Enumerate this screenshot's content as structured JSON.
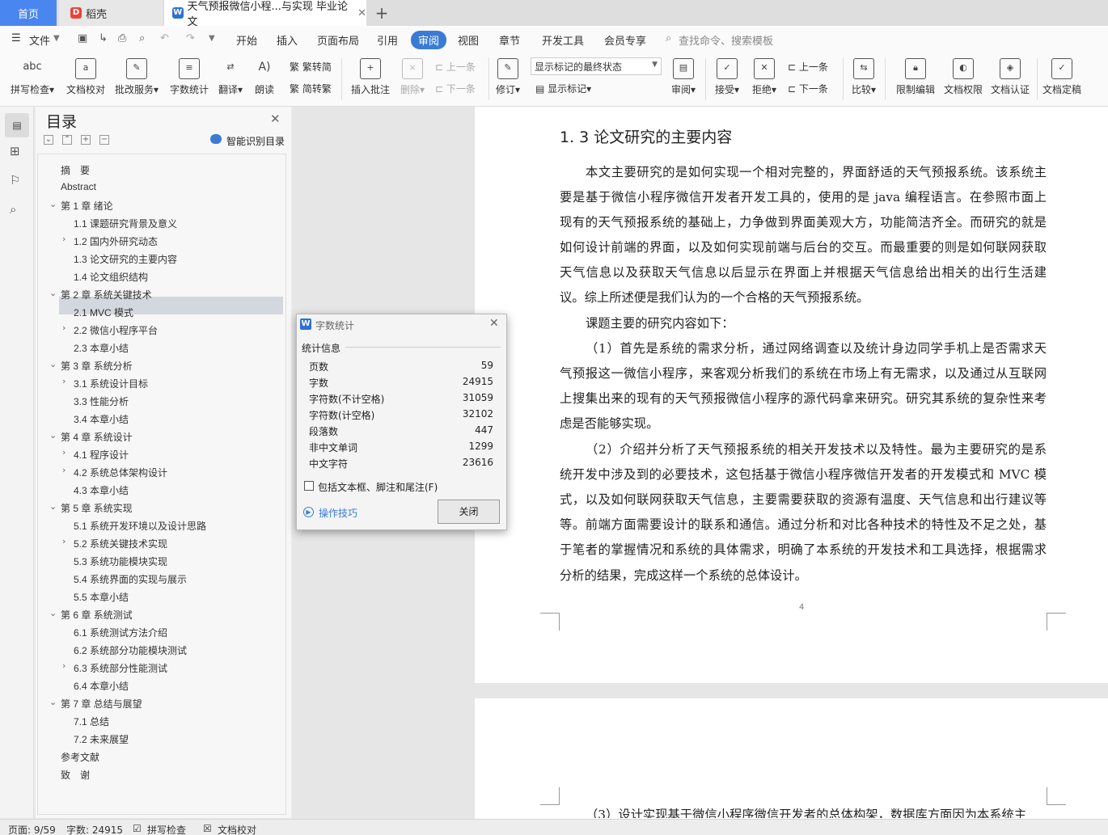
{
  "tabs": {
    "home": "首页",
    "daoke": "稻壳",
    "doc": "天气预报微信小程...与实现 毕业论文"
  },
  "menu": {
    "file": "文件",
    "items": [
      "开始",
      "插入",
      "页面布局",
      "引用",
      "审阅",
      "视图",
      "章节",
      "开发工具",
      "会员专享"
    ],
    "search": "查找命令、搜索模板"
  },
  "ribbon": {
    "spellcheck": "拼写检查",
    "doccheck": "文档校对",
    "annotate": "批改服务",
    "wordcount": "字数统计",
    "translate": "翻译",
    "read": "朗读",
    "trad": "繁转简",
    "simp": "简转繁",
    "insert_comment": "插入批注",
    "delete": "删除",
    "prev_disabled": "上一条",
    "next_disabled": "下一条",
    "revise": "修订",
    "markup_state": "显示标记的最终状态",
    "show_markup": "显示标记",
    "review": "审阅",
    "accept": "接受",
    "reject": "拒绝",
    "prev": "上一条",
    "next": "下一条",
    "compare": "比较",
    "restrict": "限制编辑",
    "perm": "文档权限",
    "auth": "文档认证",
    "finalize": "文档定稿"
  },
  "toc": {
    "title": "目录",
    "smart": "智能识别目录",
    "items": [
      "摘　要",
      "Abstract",
      "第 1 章  绪论",
      "1.1 课题研究背景及意义",
      "1.2 国内外研究动态",
      "1.3 论文研究的主要内容",
      "1.4 论文组织结构",
      "第 2 章  系统关键技术",
      "2.1 MVC 模式",
      "2.2  微信小程序平台",
      "2.3 本章小结",
      "第 3 章  系统分析",
      "3.1 系统设计目标",
      "3.3 性能分析",
      "3.4 本章小结",
      "第 4 章  系统设计",
      "4.1 程序设计",
      "4.2 系统总体架构设计",
      "4.3 本章小结",
      "第 5 章  系统实现",
      "5.1 系统开发环境以及设计思路",
      "5.2 系统关键技术实现",
      "5.3 系统功能模块实现",
      "5.4 系统界面的实现与展示",
      "5.5 本章小结",
      "第 6 章  系统测试",
      "6.1 系统测试方法介绍",
      "6.2 系统部分功能模块测试",
      "6.3 系统部分性能测试",
      "6.4 本章小结",
      "第 7 章  总结与展望",
      "7.1 总结",
      "7.2 未来展望",
      "参考文献",
      "致　谢"
    ]
  },
  "doc": {
    "heading": "1. 3 论文研究的主要内容",
    "lines": [
      "本文主要研究的是如何实现一个相对完整的，界面舒适的天气预报系统。该系统主",
      "要是基于微信小程序微信开发者开发工具的，使用的是 java 编程语言。在参照市面上",
      "现有的天气预报系统的基础上，力争做到界面美观大方，功能简洁齐全。而研究的就是",
      "如何设计前端的界面，以及如何实现前端与后台的交互。而最重要的则是如何联网获取",
      "天气信息以及获取天气信息以后显示在界面上并根据天气信息给出相关的出行生活建",
      "议。综上所述便是我们认为的一个合格的天气预报系统。",
      "课题主要的研究内容如下：",
      "（1）首先是系统的需求分析，通过网络调查以及统计身边同学手机上是否需求天",
      "气预报这一微信小程序，来客观分析我们的系统在市场上有无需求，以及通过从互联网",
      "上搜集出来的现有的天气预报微信小程序的源代码拿来研究。研究其系统的复杂性来考",
      "虑是否能够实现。",
      "（2）介绍并分析了天气预报系统的相关开发技术以及特性。最为主要研究的是系",
      "统开发中涉及到的必要技术，这包括基于微信小程序微信开发者的开发模式和 MVC 模",
      "式，以及如何联网获取天气信息，主要需要获取的资源有温度、天气信息和出行建议等",
      "等。前端方面需要设计的联系和通信。通过分析和对比各种技术的特性及不足之处，基",
      "于笔者的掌握情况和系统的具体需求，明确了本系统的开发技术和工具选择，根据需求",
      "分析的结果，完成这样一个系统的总体设计。"
    ],
    "page_num": "4",
    "next_line": "（3）设计实现基于微信小程序微信开发者的总体构架，数据库方面因为本系统主"
  },
  "dialog": {
    "title": "字数统计",
    "section": "统计信息",
    "rows": [
      {
        "k": "页数",
        "v": "59"
      },
      {
        "k": "字数",
        "v": "24915"
      },
      {
        "k": "字符数(不计空格)",
        "v": "31059"
      },
      {
        "k": "字符数(计空格)",
        "v": "32102"
      },
      {
        "k": "段落数",
        "v": "447"
      },
      {
        "k": "非中文单词",
        "v": "1299"
      },
      {
        "k": "中文字符",
        "v": "23616"
      }
    ],
    "include": "包括文本框、脚注和尾注(F)",
    "tips": "操作技巧",
    "close": "关闭"
  },
  "status": {
    "page": "页面: 9/59",
    "words": "字数: 24915",
    "spell": "拼写检查",
    "check": "文档校对"
  },
  "colors": {
    "accent": "#4a86f0",
    "selected_tab": "#3a7bd5"
  }
}
